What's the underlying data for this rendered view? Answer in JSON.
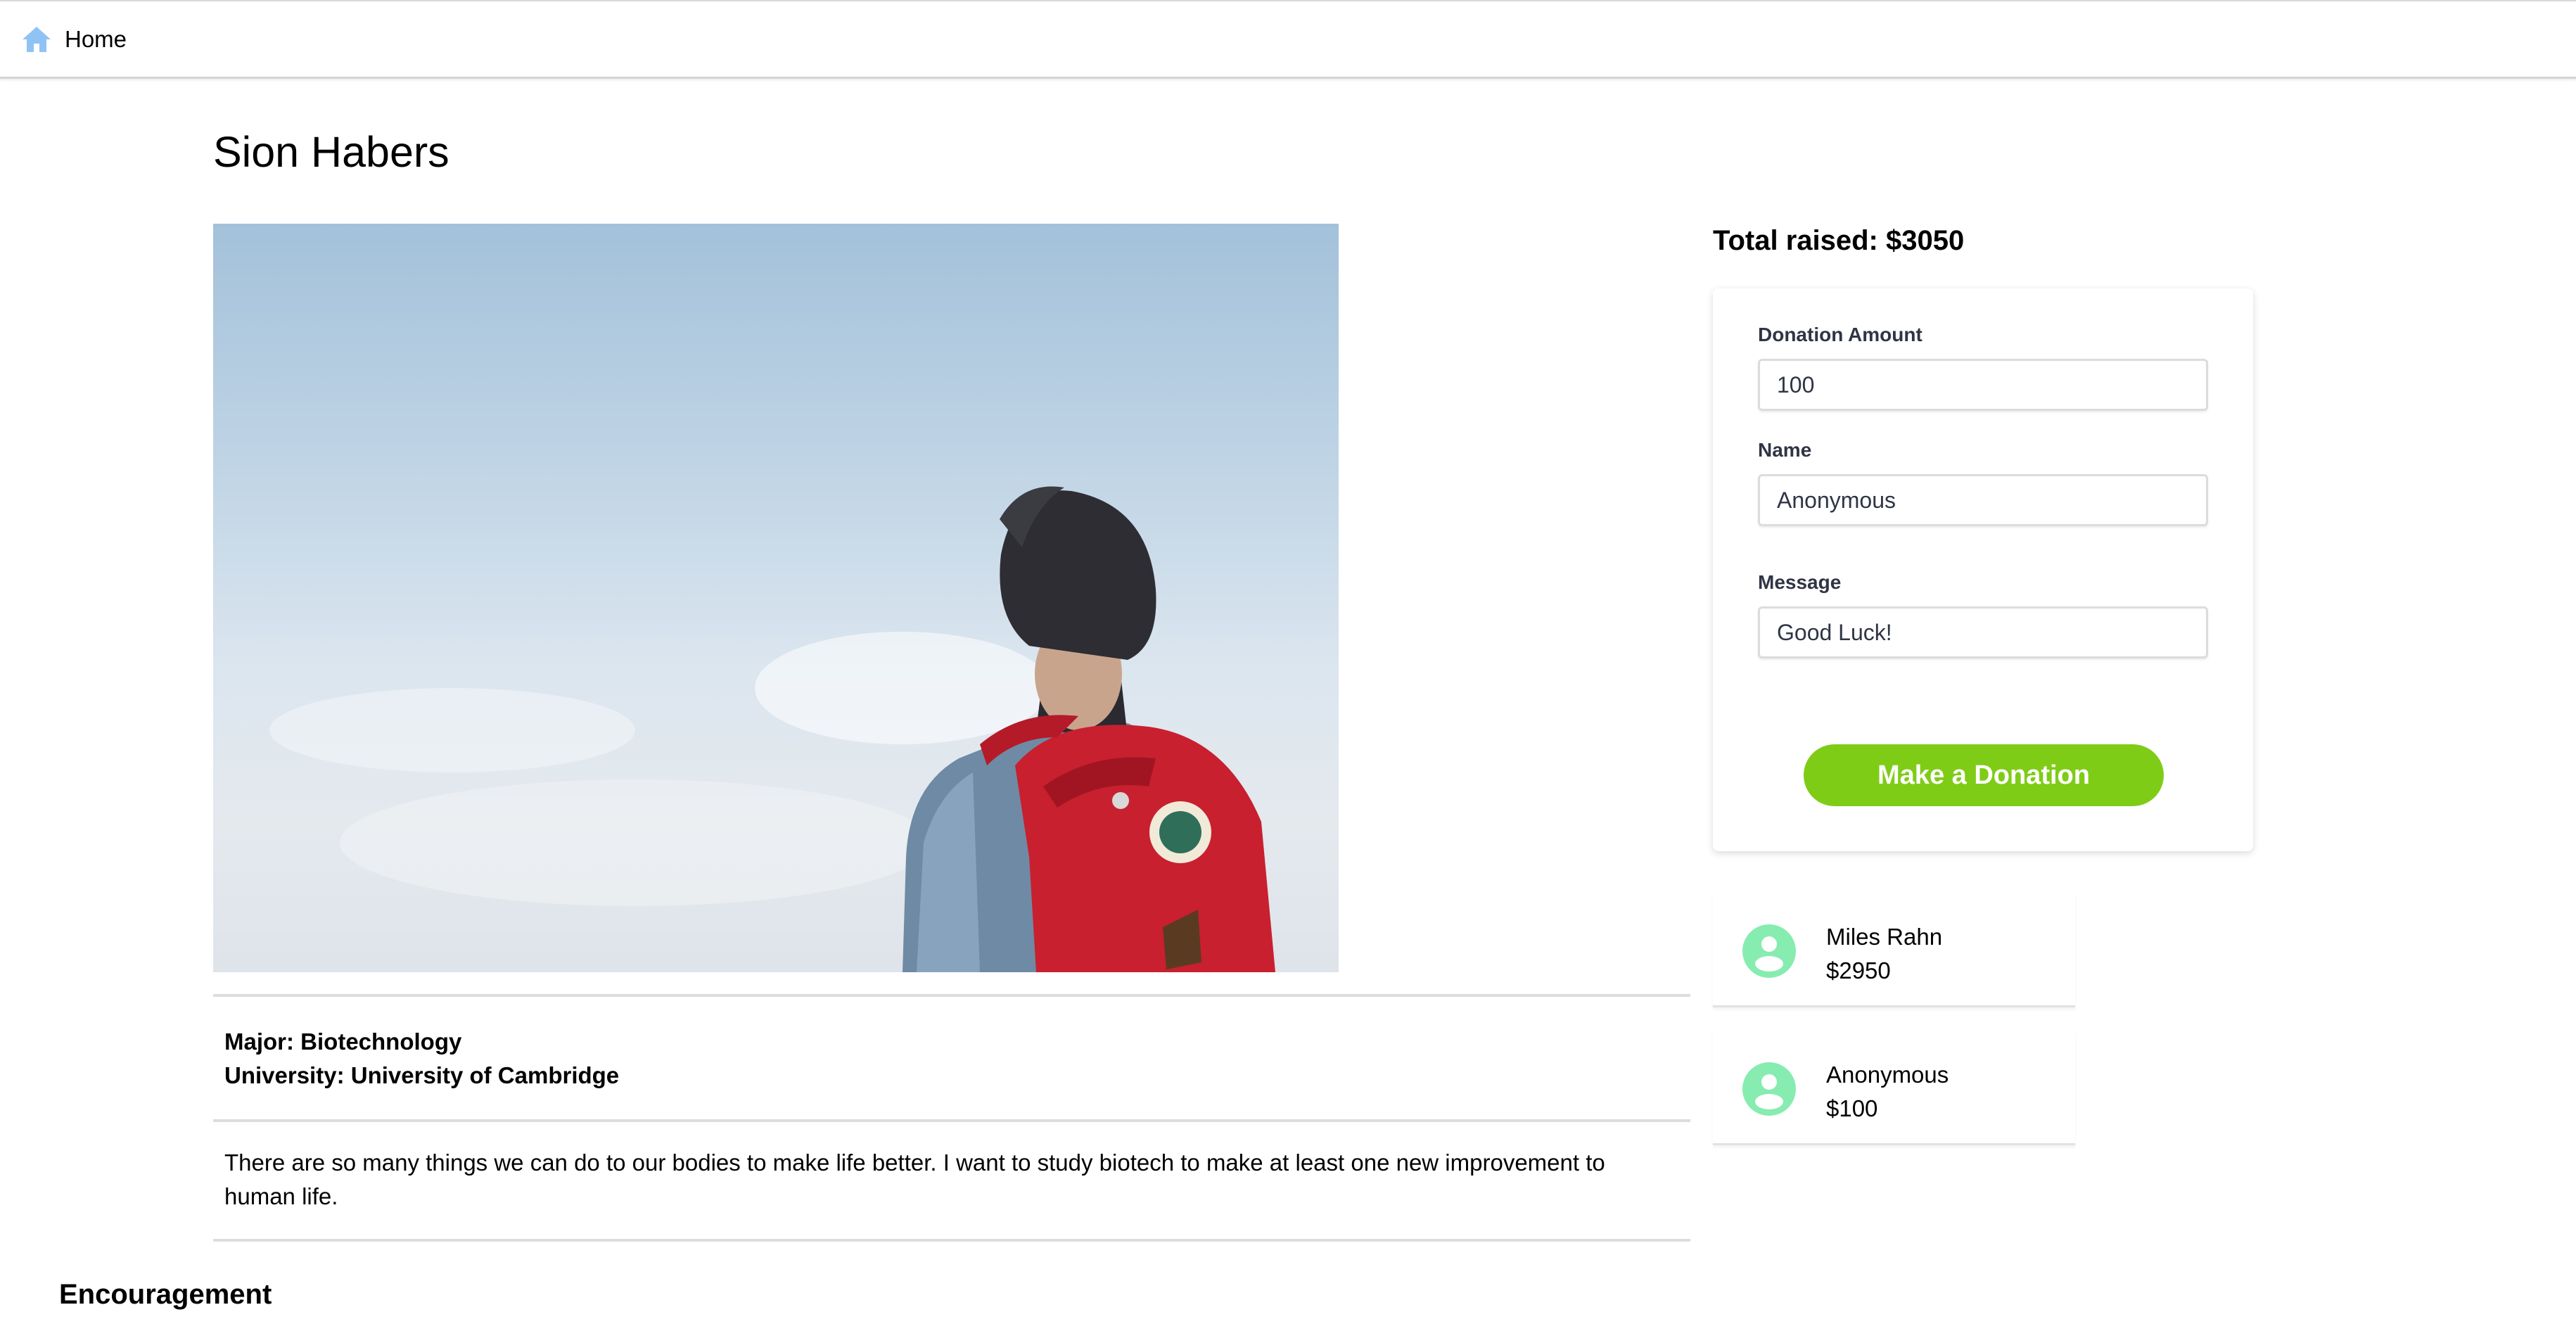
{
  "nav": {
    "home_label": "Home"
  },
  "student": {
    "name": "Sion Habers",
    "major": "Major: Biotechnology",
    "university": "University of Cambridge",
    "university_prefix": "University: ",
    "description": "There are so many things we can do to our bodies to make life better. I want to study biotech to make at least one new improvement to human life."
  },
  "donation": {
    "total_label": "Total raised: $3050",
    "amount_label": "Donation Amount",
    "amount_value": "100",
    "name_label": "Name",
    "name_value": "Anonymous",
    "message_label": "Message",
    "message_value": "Good Luck!",
    "button_label": "Make a Donation"
  },
  "donors": [
    {
      "name": "Miles Rahn",
      "amount": "$2950"
    },
    {
      "name": "Anonymous",
      "amount": "$100"
    }
  ],
  "encouragement": {
    "title": "Encouragement"
  },
  "colors": {
    "accent_green": "#7fcc17",
    "avatar_green": "#86ecb0",
    "home_icon_blue": "#8fc3f5",
    "backpack_red": "#c8202f"
  },
  "icons": {
    "home": "home-icon",
    "avatar": "user-avatar-icon"
  }
}
